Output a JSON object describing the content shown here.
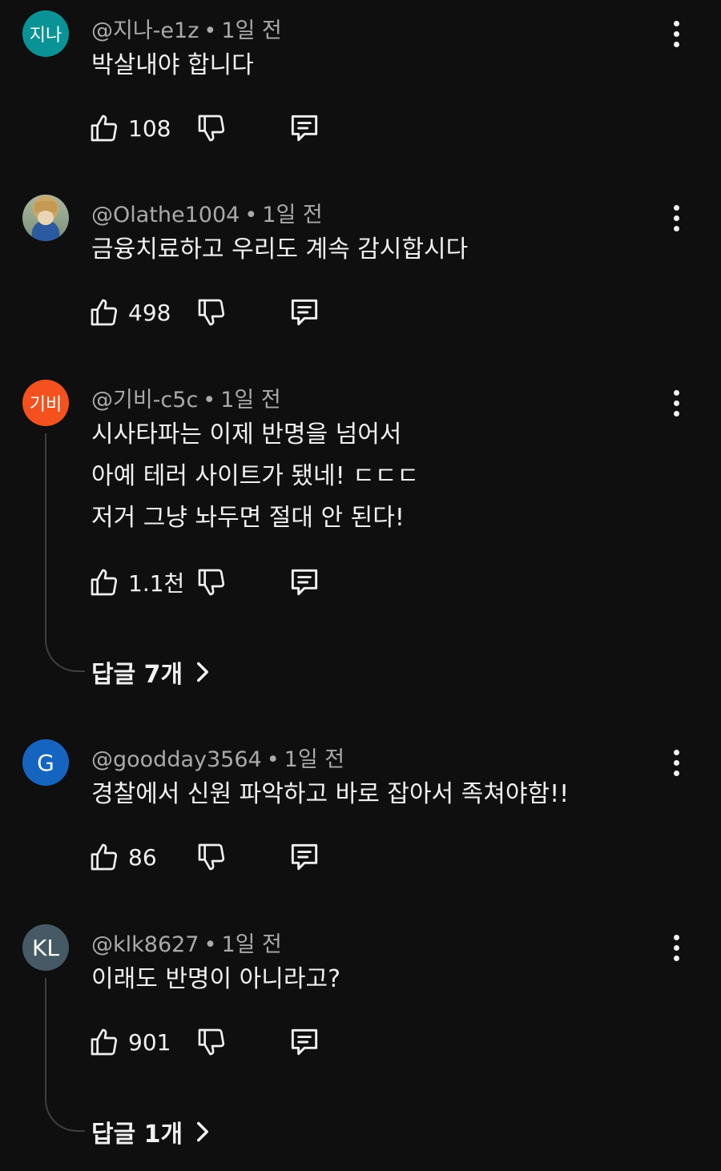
{
  "icons": {
    "like": "thumbs-up-icon",
    "dislike": "thumbs-down-icon",
    "reply": "comment-icon",
    "more": "vertical-dots-icon",
    "chevron": "chevron-right-icon"
  },
  "comments": [
    {
      "avatar_text": "지나",
      "avatar_color": "#0a9396",
      "username": "@지나-e1z",
      "time": "1일 전",
      "lines": [
        "박살내야 합니다"
      ],
      "likes": "108"
    },
    {
      "avatar_text": "",
      "avatar_color": "#8a9a86",
      "username": "@Olathe1004",
      "time": "1일 전",
      "lines": [
        "금융치료하고 우리도 계속 감시합시다"
      ],
      "likes": "498"
    },
    {
      "avatar_text": "기비",
      "avatar_color": "#f4511e",
      "username": "@기비-c5c",
      "time": "1일 전",
      "lines": [
        "시사타파는 이제 반명을 넘어서",
        "아예 테러 사이트가 됐네! ㄷㄷㄷ",
        "저거 그냥 놔두면 절대 안 된다!"
      ],
      "likes": "1.1천",
      "replies": "답글 7개"
    },
    {
      "avatar_text": "G",
      "avatar_color": "#1565c0",
      "username": "@goodday3564",
      "time": "1일 전",
      "lines": [
        "경찰에서 신원 파악하고 바로 잡아서 족쳐야함!!"
      ],
      "likes": "86"
    },
    {
      "avatar_text": "KL",
      "avatar_color": "#455a64",
      "username": "@klk8627",
      "time": "1일 전",
      "lines": [
        "이래도 반명이 아니라고?"
      ],
      "likes": "901",
      "replies": "답글 1개"
    }
  ]
}
